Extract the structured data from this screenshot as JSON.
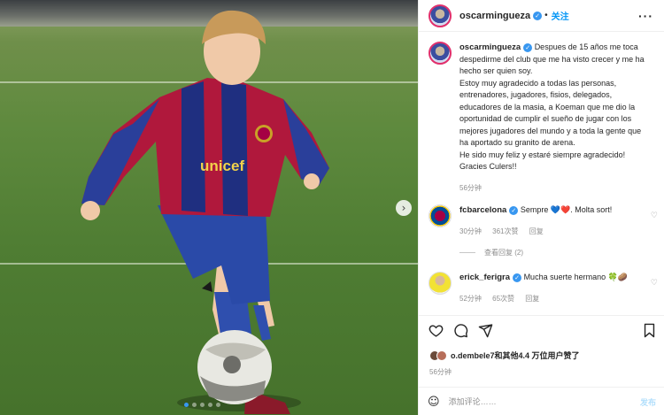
{
  "post": {
    "username": "oscarmingueza",
    "follow_label": "关注",
    "dot": "•",
    "caption": "Despues de 15 años me toca despedirme del club que me ha visto crecer y me ha hecho ser quien soy.\nEstoy muy agradecido a todas las personas, entrenadores, jugadores, fisios, delegados, educadores de la masia, a Koeman que me dio la oportunidad de cumplir el sueño de jugar con los mejores jugadores del mundo y a toda la gente que ha aportado su granito de arena.\nHe sido muy feliz y estaré siempre agradecido!\nGracies Culers!!",
    "caption_time": "56分钟"
  },
  "comments": [
    {
      "username": "fcbarcelona",
      "text": "Sempre 💙❤️. Molta sort!",
      "time": "30分钟",
      "likes": "361次赞",
      "reply": "回复",
      "view_replies": "查看回复 (2)"
    },
    {
      "username": "erick_ferigra",
      "text": "Mucha suerte hermano 🍀🥔",
      "time": "52分钟",
      "likes": "65次赞",
      "reply": "回复"
    }
  ],
  "likes_summary": {
    "user": "o.dembele7",
    "rest": "和其他4.4 万位用户赞了"
  },
  "post_time": "56分钟",
  "comment_box": {
    "placeholder": "添加评论……",
    "submit": "发布"
  },
  "icons": [
    "heart-icon",
    "comment-icon",
    "share-icon",
    "bookmark-icon",
    "emoji-icon",
    "more-icon",
    "carousel-next-icon"
  ],
  "colors": {
    "accent": "#0095f6",
    "verified": "#3897f0"
  }
}
